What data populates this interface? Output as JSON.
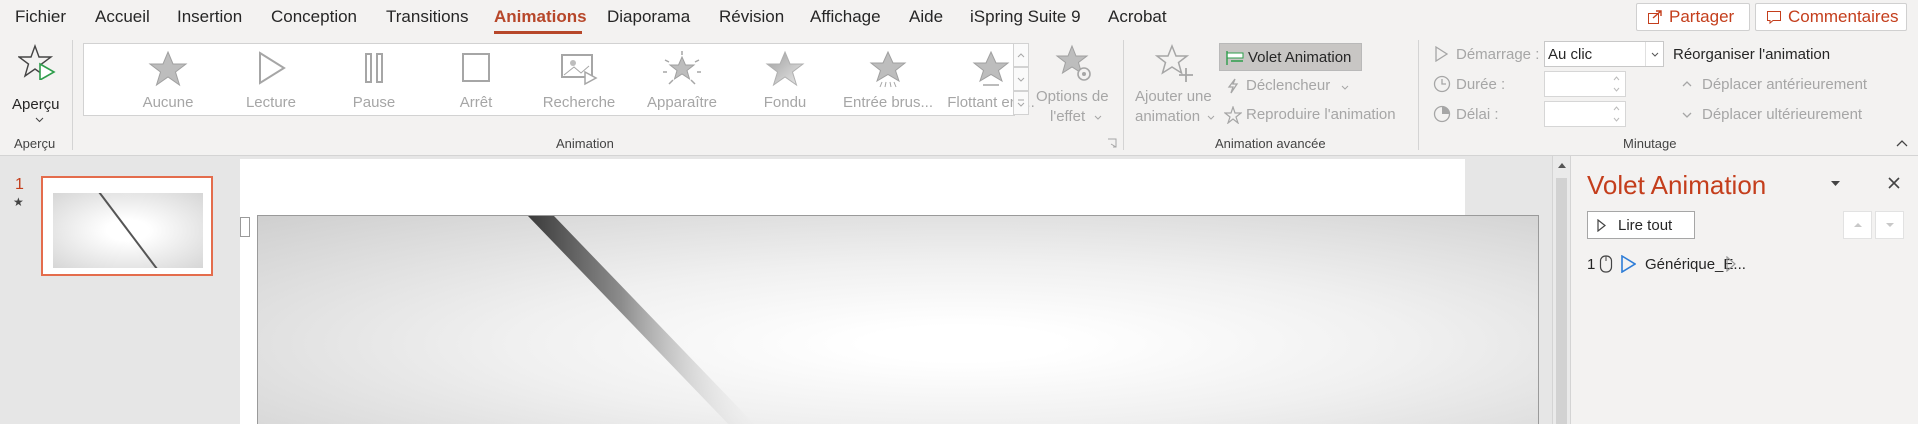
{
  "menu": {
    "tabs": [
      {
        "label": "Fichier"
      },
      {
        "label": "Accueil"
      },
      {
        "label": "Insertion"
      },
      {
        "label": "Conception"
      },
      {
        "label": "Transitions"
      },
      {
        "label": "Animations",
        "active": true
      },
      {
        "label": "Diaporama"
      },
      {
        "label": "Révision"
      },
      {
        "label": "Affichage"
      },
      {
        "label": "Aide"
      },
      {
        "label": "iSpring Suite 9"
      },
      {
        "label": "Acrobat"
      }
    ],
    "share_label": "Partager",
    "comments_label": "Commentaires"
  },
  "ribbon": {
    "preview": {
      "button_label": "Aperçu",
      "group_label": "Aperçu"
    },
    "animation": {
      "group_label": "Animation",
      "gallery": [
        {
          "label": "Aucune",
          "icon": "star-outline-icon"
        },
        {
          "label": "Lecture",
          "icon": "play-icon"
        },
        {
          "label": "Pause",
          "icon": "pause-icon"
        },
        {
          "label": "Arrêt",
          "icon": "stop-icon"
        },
        {
          "label": "Recherche",
          "icon": "seek-icon"
        },
        {
          "label": "Apparaître",
          "icon": "appear-star-icon"
        },
        {
          "label": "Fondu",
          "icon": "fade-star-icon"
        },
        {
          "label": "Entrée brus...",
          "icon": "fly-in-star-icon"
        },
        {
          "label": "Flottant ent...",
          "icon": "float-in-star-icon"
        }
      ],
      "effect_options": {
        "line1": "Options de",
        "line2": "l'effet"
      }
    },
    "advanced": {
      "group_label": "Animation avancée",
      "add_animation": {
        "line1": "Ajouter une",
        "line2": "animation"
      },
      "pane_button": "Volet Animation",
      "trigger": "Déclencheur",
      "painter": "Reproduire l'animation"
    },
    "timing": {
      "group_label": "Minutage",
      "start_label": "Démarrage :",
      "start_value": "Au clic",
      "duration_label": "Durée :",
      "duration_value": "",
      "delay_label": "Délai :",
      "delay_value": "",
      "reorder_title": "Réorganiser l'animation",
      "move_earlier": "Déplacer antérieurement",
      "move_later": "Déplacer ultérieurement"
    }
  },
  "slides": [
    {
      "number": "1",
      "star": "★"
    }
  ],
  "anim_pane": {
    "title": "Volet Animation",
    "play_all": "Lire tout",
    "items": [
      {
        "index": "1",
        "name": "Générique_E..."
      }
    ]
  },
  "colors": {
    "accent": "#b7472a",
    "pane_title": "#c43e1c"
  }
}
